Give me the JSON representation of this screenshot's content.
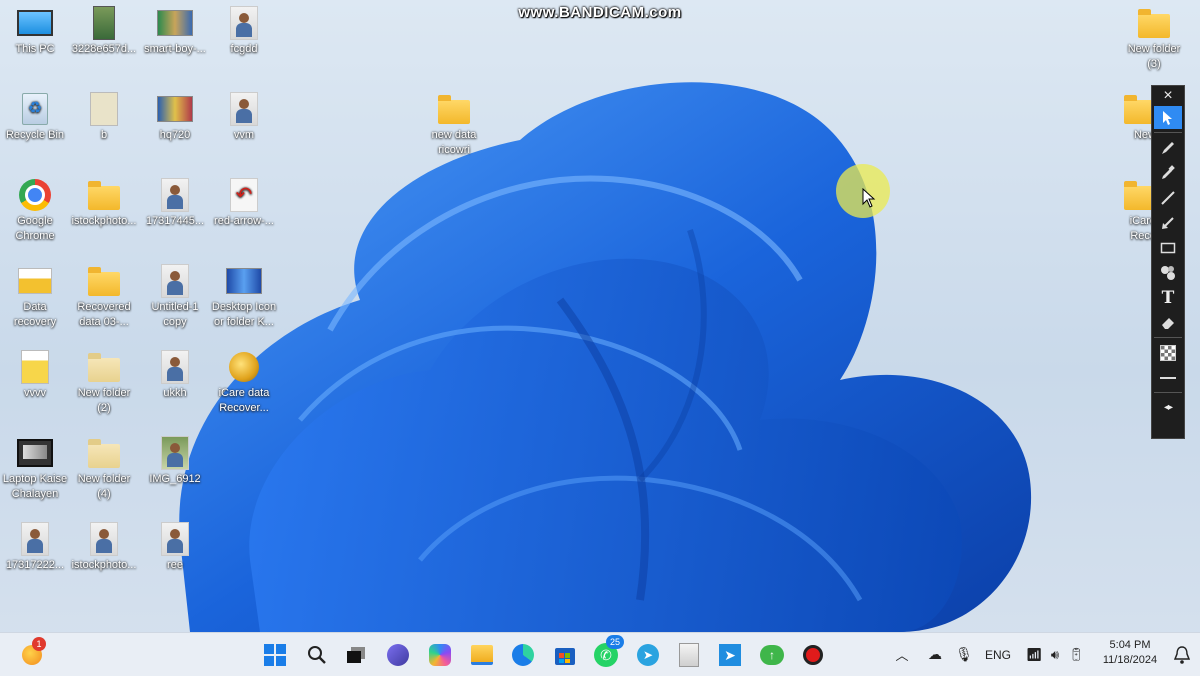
{
  "watermark": "www.BANDICAM.com",
  "desktop_icons": [
    {
      "name": "this-pc",
      "label": "This PC",
      "kind": "monitor"
    },
    {
      "name": "file-3228",
      "label": "3228e657d...",
      "kind": "photo-tall"
    },
    {
      "name": "smart-boy",
      "label": "smart-boy-...",
      "kind": "thumb-wide"
    },
    {
      "name": "fcgdd",
      "label": "fcgdd",
      "kind": "photo"
    },
    {
      "name": "recycle-bin",
      "label": "Recycle Bin",
      "kind": "recycle"
    },
    {
      "name": "b",
      "label": "b",
      "kind": "doc"
    },
    {
      "name": "hq720",
      "label": "hq720",
      "kind": "thumb-wide"
    },
    {
      "name": "vvm",
      "label": "vvm",
      "kind": "photo"
    },
    {
      "name": "google-chrome",
      "label": "Google\nChrome",
      "kind": "chrome"
    },
    {
      "name": "istockphoto-1",
      "label": "istockphoto...",
      "kind": "folder-photo"
    },
    {
      "name": "file-1731744",
      "label": "17317445...",
      "kind": "photo"
    },
    {
      "name": "red-arrow",
      "label": "red-arrow-...",
      "kind": "arrow"
    },
    {
      "name": "data-recovery",
      "label": "Data\nrecovery",
      "kind": "data-recovery"
    },
    {
      "name": "recovered-data",
      "label": "Recovered\ndata 03-...",
      "kind": "folder"
    },
    {
      "name": "untitled-copy",
      "label": "Untitled-1\ncopy",
      "kind": "photo"
    },
    {
      "name": "desktop-icon-folder",
      "label": "Desktop Icon\nor folder K...",
      "kind": "thumb-wide"
    },
    {
      "name": "vvvv",
      "label": "vvvv",
      "kind": "doc-yellow"
    },
    {
      "name": "new-folder-2",
      "label": "New folder\n(2)",
      "kind": "folder-pale"
    },
    {
      "name": "ukkh",
      "label": "ukkh",
      "kind": "photo"
    },
    {
      "name": "icare-data-recovery",
      "label": "iCare data\nRecover...",
      "kind": "icare"
    },
    {
      "name": "laptop-kaise-chalayen",
      "label": "Laptop Kaise\nChalayen",
      "kind": "film"
    },
    {
      "name": "new-folder-4",
      "label": "New folder\n(4)",
      "kind": "folder-pale"
    },
    {
      "name": "img-6912",
      "label": "IMG_6912",
      "kind": "photo"
    },
    {
      "name": "file-1731722",
      "label": "17317222...",
      "kind": "photo"
    },
    {
      "name": "istockphoto-2",
      "label": "istockphoto...",
      "kind": "photo"
    },
    {
      "name": "ree",
      "label": "ree",
      "kind": "photo"
    },
    {
      "name": "new-data-ricowri",
      "label": "new data\nricowri",
      "kind": "folder"
    },
    {
      "name": "new-folder-3",
      "label": "New folder\n(3)",
      "kind": "folder"
    },
    {
      "name": "new-folder-partial",
      "label": "New",
      "kind": "folder"
    },
    {
      "name": "icare-partial",
      "label": "iCare\nReco",
      "kind": "folder"
    }
  ],
  "drawing_toolbar": {
    "close": "×",
    "tools": [
      "pointer-icon",
      "pen-icon",
      "highlighter-icon",
      "line-icon",
      "arrow-icon",
      "rectangle-icon",
      "numbering-icon",
      "text-icon",
      "eraser-icon",
      "checker-icon",
      "line-width-icon",
      "arrows-icon"
    ]
  },
  "taskbar": {
    "notification_badge": "1",
    "whatsapp_badge": "25",
    "language": "ENG",
    "time": "5:04 PM",
    "date": "11/18/2024"
  },
  "colors": {
    "accent": "#2f8bf3",
    "wallpaper_bloom": "#1d6de0",
    "taskbar": "#e9eef5"
  }
}
